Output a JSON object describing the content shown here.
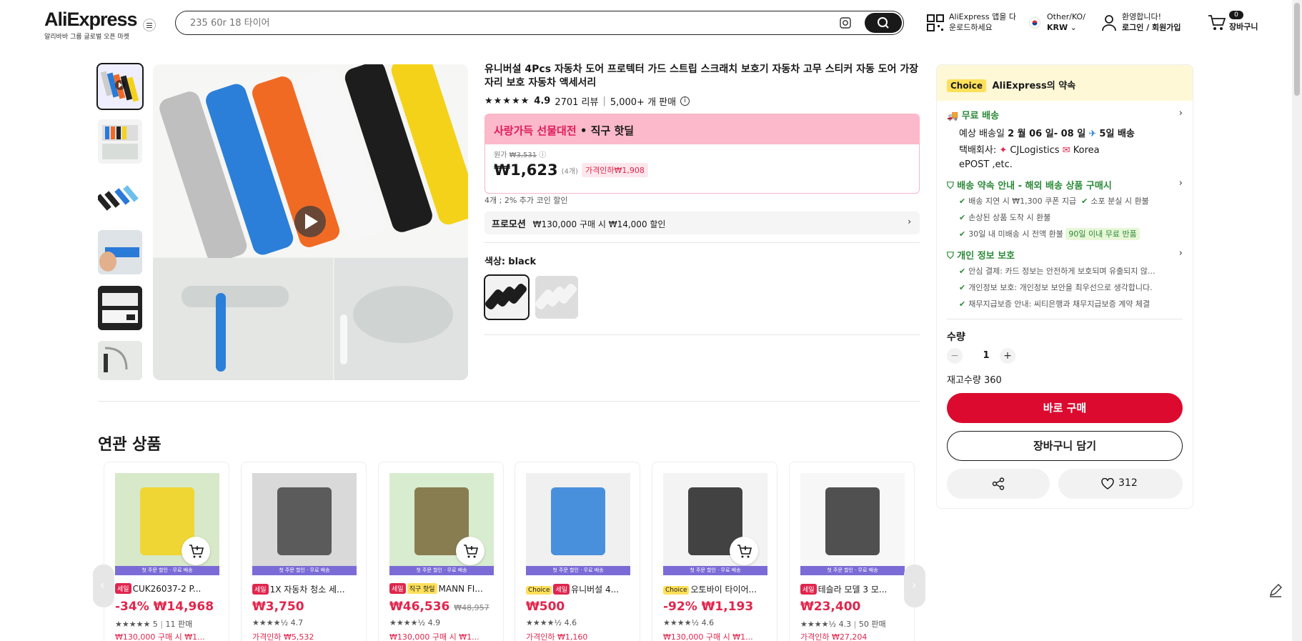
{
  "header": {
    "logo": "AliExpress",
    "logo_sub": "알리바바 그룹 글로벌 오픈 마켓",
    "search_placeholder": "235 60r 18 타이어",
    "app_line1": "AliExpress 앱을 다",
    "app_line2": "운로드하세요",
    "region_line1": "Other/KO/",
    "region_line2": "KRW",
    "user_line1": "환영합니다!",
    "user_line2": "로그인 / 회원가입",
    "cart_count": "0",
    "cart_label": "장바구니"
  },
  "product": {
    "title": "유니버설 4Pcs 자동차 도어 프로텍터 가드 스트립 스크래치 보호기 자동차 고무 스티커 자동 도어 가장자리 보호 자동차 액세서리",
    "rating": "4.9",
    "reviews": "2701 리뷰",
    "sold": "5,000+ 개 판매",
    "banner_hl": "사랑가득 선물대전",
    "banner_rest": "• 직구 핫딜",
    "orig_label": "원가",
    "orig_price": "₩3,531",
    "price": "₩1,623",
    "unit": "(4개)",
    "discount": "가격인하₩1,908",
    "coin": "4개 ; 2% 추가 코인 할인",
    "promo_label": "프로모션",
    "promo_text": "₩130,000 구매 시 ₩14,000 할인",
    "color_label": "색상:",
    "color_value": "black"
  },
  "related": {
    "title": "연관 상품",
    "strip": "첫 주문 할인 · 무료 배송",
    "items": [
      {
        "tags": [
          "세일"
        ],
        "name": "CUK26037-2 P...",
        "price": "-34% ₩14,968",
        "old": "",
        "rating": "★★★★★ 5",
        "sold": "11 판매",
        "promo": "₩130,000 구매 시 ₩1..."
      },
      {
        "tags": [
          "세일"
        ],
        "name": "1X 자동차 청소 세...",
        "price": "₩3,750",
        "old": "",
        "rating": "★★★★½ 4.7",
        "sold": "",
        "promo": "가격인하 ₩5,532"
      },
      {
        "tags": [
          "세일",
          "직구 핫딜"
        ],
        "name": "MANN FI...",
        "price": "₩46,536",
        "old": "₩48,957",
        "rating": "★★★★½ 4.9",
        "sold": "",
        "promo": "₩130,000 구매 시 ₩1..."
      },
      {
        "tags": [
          "Choice",
          "세일"
        ],
        "name": "유니버설 4...",
        "price": "₩500",
        "old": "",
        "rating": "★★★★½ 4.6",
        "sold": "",
        "promo": "가격인하 ₩1,160"
      },
      {
        "tags": [
          "Choice"
        ],
        "name": "오토바이 타이어...",
        "price": "-92% ₩1,193",
        "old": "",
        "rating": "★★★★½ 4.6",
        "sold": "",
        "promo": "₩130,000 구매 시 ₩1..."
      },
      {
        "tags": [
          "세일"
        ],
        "name": "테슬라 모델 3 모...",
        "price": "₩23,400",
        "old": "",
        "rating": "★★★★½ 4.3",
        "sold": "50 판매",
        "promo": "가격인하 ₩27,204"
      }
    ]
  },
  "panel": {
    "choice_badge": "Choice",
    "choice_text": "AliExpress의 약속",
    "ship_title": "무료 배송",
    "ship_est_prefix": "예상 배송일",
    "ship_est_dates": "2 월 06 일- 08 일",
    "ship_days": "5일 배송",
    "carrier_prefix": "택배회사:",
    "carrier1": "CJLogistics",
    "carrier2": "Korea",
    "carrier3": "ePOST ,etc.",
    "guarantee_title": "배송 약속 안내 - 해외 배송 상품 구매시",
    "g1": "배송 지연 시 ₩1,300 쿠폰 지급",
    "g2": "소포 분실 시 환불",
    "g3": "손상된 상품 도착 시 환불",
    "g4": "30일 내 미배송 시 전액 환불",
    "g4_badge": "90일 이내 무료 반품",
    "privacy_title": "개인 정보 보호",
    "p1": "안심 결제: 카드 정보는 안전하게 보호되며 유출되지 않...",
    "p2": "개인정보 보호: 개인정보 보안을 최우선으로 생각합니다.",
    "p3": "채무지급보증 안내: 씨티은행과 채무지급보증 계약 체결",
    "qty_label": "수량",
    "qty_value": "1",
    "stock": "재고수량 360",
    "buy_now": "바로 구매",
    "add_cart": "장바구니 담기",
    "wish_count": "312"
  }
}
